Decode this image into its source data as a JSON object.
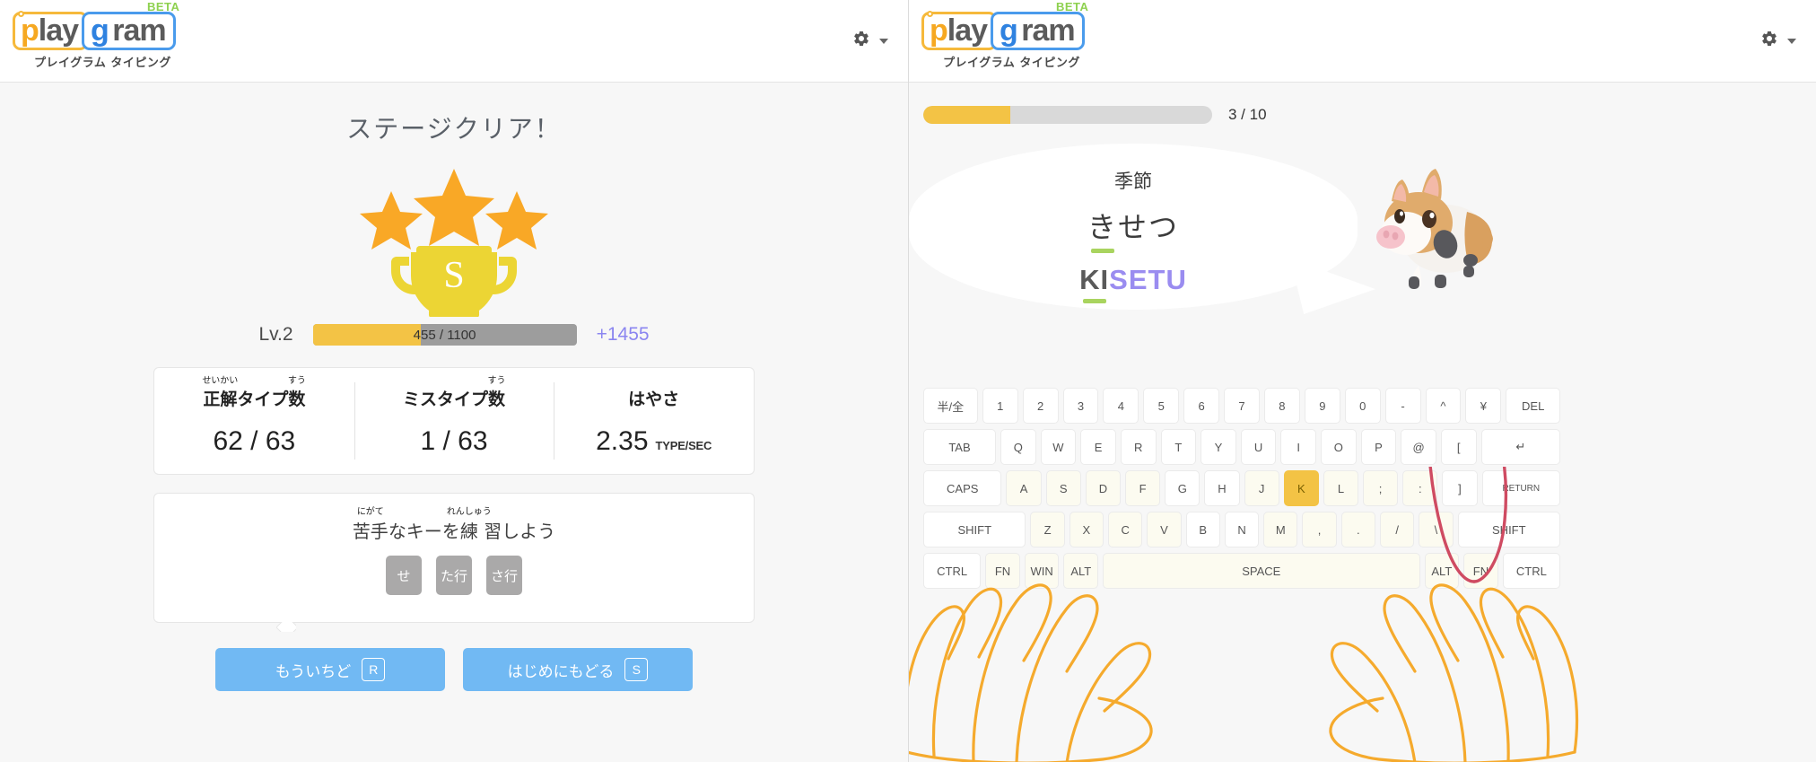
{
  "header": {
    "logo": {
      "play": "play",
      "p": "p",
      "lay": "lay",
      "g": "g",
      "ram": "ram",
      "beta": "BETA",
      "subtitle": "プレイグラム タイピング"
    },
    "settings_icon": "gear-icon",
    "dropdown_icon": "chevron-down-icon"
  },
  "result": {
    "title": "ステージクリア！",
    "rank": "S",
    "stars": 3,
    "level_label": "Lv.2",
    "xp_current": 455,
    "xp_total": 1100,
    "xp_text": "455 / 1100",
    "xp_percent": 41,
    "xp_gain": "+1455",
    "stats": [
      {
        "label": "正解タイプ数",
        "ruby_parts": [
          {
            "base": "正解",
            "rt": "せいかい"
          },
          {
            "base": "タイプ",
            "rt": ""
          },
          {
            "base": "数",
            "rt": "すう"
          }
        ],
        "value": "62 / 63",
        "unit": ""
      },
      {
        "label": "ミスタイプ数",
        "ruby_parts": [
          {
            "base": "ミスタイプ",
            "rt": ""
          },
          {
            "base": "数",
            "rt": "すう"
          }
        ],
        "value": "1 / 63",
        "unit": ""
      },
      {
        "label": "はやさ",
        "ruby_parts": [
          {
            "base": "はやさ",
            "rt": ""
          }
        ],
        "value": "2.35",
        "unit": "TYPE/SEC"
      }
    ],
    "weak": {
      "title": "苦手なキーを練習しよう",
      "ruby_parts": [
        {
          "base": "苦手",
          "rt": "にがて"
        },
        {
          "base": "なキーを",
          "rt": ""
        },
        {
          "base": "練",
          "rt": "れんしゅう"
        },
        {
          "base": "習しよう",
          "rt": ""
        }
      ],
      "keys": [
        "せ",
        "た行",
        "さ行"
      ]
    },
    "buttons": [
      {
        "label": "もういちど",
        "shortcut": "R"
      },
      {
        "label": "はじめにもどる",
        "shortcut": "S"
      }
    ]
  },
  "practice": {
    "progress_current": 3,
    "progress_total": 10,
    "progress_text": "3 / 10",
    "progress_percent": 30,
    "word_kanji": "季節",
    "word_kana": "きせつ",
    "romaji_typed": "KI",
    "romaji_remaining": "SETU",
    "mascot": "boar-mascot"
  },
  "keyboard": {
    "highlight_key": "K",
    "rows": [
      {
        "keys": [
          {
            "label": "半/全",
            "w": "w15"
          },
          {
            "label": "1"
          },
          {
            "label": "2"
          },
          {
            "label": "3"
          },
          {
            "label": "4"
          },
          {
            "label": "5"
          },
          {
            "label": "6"
          },
          {
            "label": "7"
          },
          {
            "label": "8"
          },
          {
            "label": "9"
          },
          {
            "label": "0"
          },
          {
            "label": "-"
          },
          {
            "label": "^"
          },
          {
            "label": "¥"
          },
          {
            "label": "DEL",
            "w": "w15"
          }
        ]
      },
      {
        "keys": [
          {
            "label": "TAB",
            "w": "w20"
          },
          {
            "label": "Q"
          },
          {
            "label": "W"
          },
          {
            "label": "E"
          },
          {
            "label": "R"
          },
          {
            "label": "T"
          },
          {
            "label": "Y"
          },
          {
            "label": "U"
          },
          {
            "label": "I"
          },
          {
            "label": "O"
          },
          {
            "label": "P"
          },
          {
            "label": "@"
          },
          {
            "label": "["
          },
          {
            "label": "↵",
            "w": "w22"
          }
        ]
      },
      {
        "keys": [
          {
            "label": "CAPS",
            "w": "w22"
          },
          {
            "label": "A",
            "t": true
          },
          {
            "label": "S",
            "t": true
          },
          {
            "label": "D",
            "t": true
          },
          {
            "label": "F",
            "t": true
          },
          {
            "label": "G"
          },
          {
            "label": "H"
          },
          {
            "label": "J",
            "t": true
          },
          {
            "label": "K",
            "hi": true
          },
          {
            "label": "L",
            "t": true
          },
          {
            "label": ";",
            "t": true
          },
          {
            "label": ":",
            "t": true
          },
          {
            "label": "]"
          },
          {
            "label": "RETURN",
            "w": "w22",
            "sm": true
          }
        ]
      },
      {
        "keys": [
          {
            "label": "SHIFT",
            "w": "w30"
          },
          {
            "label": "Z",
            "t": true
          },
          {
            "label": "X",
            "t": true
          },
          {
            "label": "C",
            "t": true
          },
          {
            "label": "V",
            "t": true
          },
          {
            "label": "B"
          },
          {
            "label": "N"
          },
          {
            "label": "M",
            "t": true
          },
          {
            "label": ",",
            "t": true
          },
          {
            "label": ".",
            "t": true
          },
          {
            "label": "/",
            "t": true
          },
          {
            "label": "\\",
            "t": true
          },
          {
            "label": "SHIFT",
            "w": "w30"
          }
        ]
      },
      {
        "keys": [
          {
            "label": "CTRL",
            "w": "w17"
          },
          {
            "label": "FN",
            "t": true
          },
          {
            "label": "WIN",
            "t": true
          },
          {
            "label": "ALT",
            "t": true
          },
          {
            "label": "SPACE",
            "w": "space",
            "t": true
          },
          {
            "label": "ALT",
            "t": true
          },
          {
            "label": "FN",
            "t": true
          },
          {
            "label": "CTRL",
            "w": "w17"
          }
        ]
      }
    ]
  },
  "colors": {
    "accent_yellow": "#f3c345",
    "accent_blue": "#71b9f3",
    "purple": "#9a8cf0",
    "green": "#a9d45f",
    "gray_key": "#aaa9a9"
  }
}
